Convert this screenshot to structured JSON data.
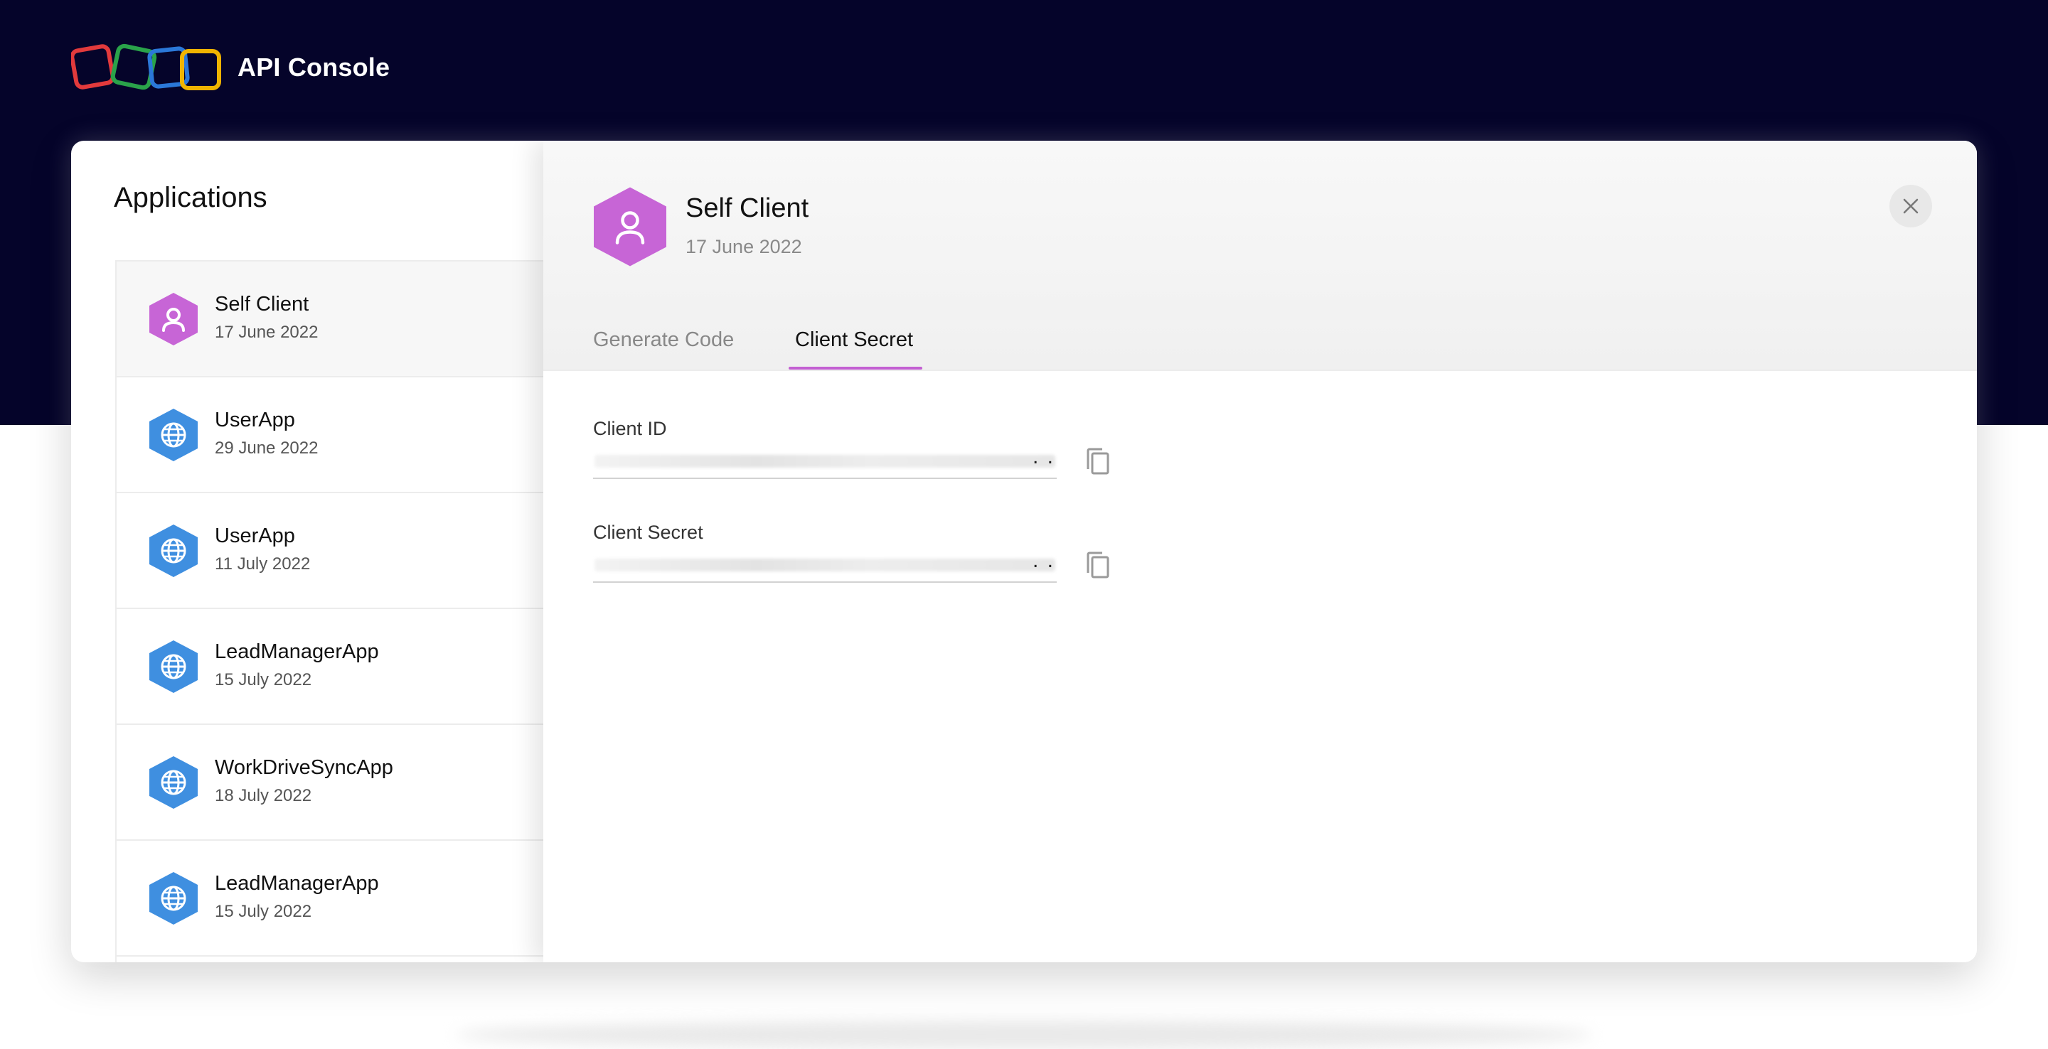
{
  "header": {
    "title": "API Console",
    "logo_icon": "zoho-logo-icon"
  },
  "applications": {
    "title": "Applications",
    "items": [
      {
        "name": "Self Client",
        "date": "17 June 2022",
        "icon": "user-icon",
        "color": "#c765d6",
        "active": true
      },
      {
        "name": "UserApp",
        "date": "29 June 2022",
        "icon": "globe-icon",
        "color": "#3f8fe0"
      },
      {
        "name": "UserApp",
        "date": "11 July 2022",
        "icon": "globe-icon",
        "color": "#3f8fe0"
      },
      {
        "name": "LeadManagerApp",
        "date": "15 July 2022",
        "icon": "globe-icon",
        "color": "#3f8fe0"
      },
      {
        "name": "WorkDriveSyncApp",
        "date": "18 July 2022",
        "icon": "globe-icon",
        "color": "#3f8fe0"
      },
      {
        "name": "LeadManagerApp",
        "date": "15 July 2022",
        "icon": "globe-icon",
        "color": "#3f8fe0"
      }
    ]
  },
  "detail": {
    "title": "Self Client",
    "date": "17 June 2022",
    "close_icon": "close-icon",
    "tabs": [
      {
        "label": "Generate Code",
        "active": false
      },
      {
        "label": "Client Secret",
        "active": true
      }
    ],
    "fields": [
      {
        "label": "Client ID",
        "value_suffix": ". ."
      },
      {
        "label": "Client Secret",
        "value_suffix": ". ."
      }
    ]
  },
  "colors": {
    "header_bg": "#05042a",
    "accent": "#c35fd2",
    "self_client": "#c765d6",
    "app_blue": "#3f8fe0"
  }
}
